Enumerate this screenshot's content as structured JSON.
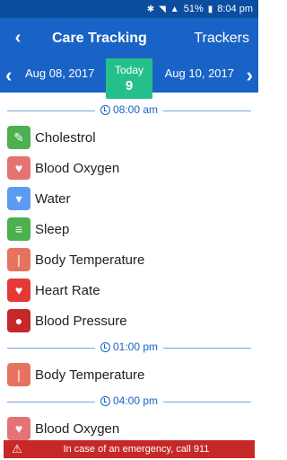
{
  "status": {
    "battery": "51%",
    "time": "8:04 pm"
  },
  "header": {
    "title": "Care Tracking",
    "trackers_label": "Trackers"
  },
  "datebar": {
    "prev_date": "Aug 08, 2017",
    "next_date": "Aug 10, 2017",
    "today_label": "Today",
    "today_day": "9"
  },
  "sections": [
    {
      "time": "08:00 am",
      "items": [
        {
          "label": "Cholestrol",
          "icon": "cholesterol-icon",
          "color": "#4caf50"
        },
        {
          "label": "Blood Oxygen",
          "icon": "blood-oxygen-icon",
          "color": "#e57373"
        },
        {
          "label": "Water",
          "icon": "water-icon",
          "color": "#5b9cf2"
        },
        {
          "label": "Sleep",
          "icon": "sleep-icon",
          "color": "#4caf50"
        },
        {
          "label": "Body Temperature",
          "icon": "thermometer-icon",
          "color": "#e57360"
        },
        {
          "label": "Heart Rate",
          "icon": "heart-rate-icon",
          "color": "#e53935"
        },
        {
          "label": "Blood Pressure",
          "icon": "blood-pressure-icon",
          "color": "#c62828"
        }
      ]
    },
    {
      "time": "01:00 pm",
      "items": [
        {
          "label": "Body Temperature",
          "icon": "thermometer-icon",
          "color": "#e57360"
        }
      ]
    },
    {
      "time": "04:00 pm",
      "items": [
        {
          "label": "Blood Oxygen",
          "icon": "blood-oxygen-icon",
          "color": "#e57373"
        }
      ]
    }
  ],
  "emergency": {
    "text": "In case of an emergency, call 911"
  }
}
